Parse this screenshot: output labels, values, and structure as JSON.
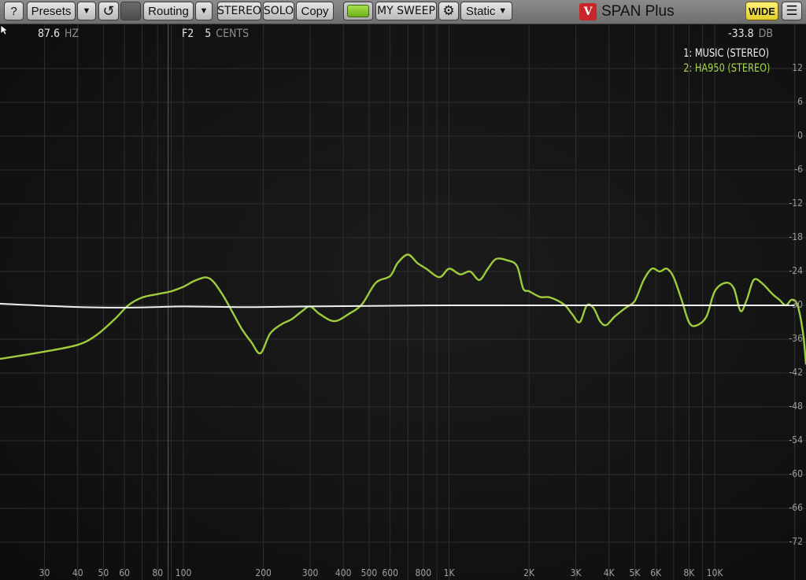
{
  "toolbar": {
    "help": "?",
    "presets": "Presets",
    "dropdown_arrow": "▼",
    "undo_icon": "↺",
    "routing": "Routing",
    "stereo": "STEREO",
    "solo": "SOLO",
    "copy": "Copy",
    "sweep": "MY SWEEP",
    "gear_icon": "⚙",
    "mode": "Static",
    "product": "SPAN Plus",
    "wide": "WIDE",
    "menu_icon": "☰"
  },
  "readout": {
    "freq": "87.6",
    "freq_unit": "HZ",
    "note": "F2",
    "cents": "5",
    "cents_unit": "CENTS",
    "level": "-33.8",
    "level_unit": "DB"
  },
  "legend": {
    "item1": "1: MUSIC (STEREO)",
    "item2": "2: HA950 (STEREO)"
  },
  "colors": {
    "series1": "#f0f0f0",
    "series2": "#9dcc3c",
    "grid": "#2e2e2e"
  },
  "y_axis": [
    "12",
    "6",
    "0",
    "-6",
    "-12",
    "-18",
    "-24",
    "-30",
    "-36",
    "-42",
    "-48",
    "-54",
    "-60",
    "-66",
    "-72"
  ],
  "x_axis": [
    {
      "f": 30,
      "label": "30"
    },
    {
      "f": 40,
      "label": "40"
    },
    {
      "f": 50,
      "label": "50"
    },
    {
      "f": 60,
      "label": "60"
    },
    {
      "f": 80,
      "label": "80"
    },
    {
      "f": 100,
      "label": "100"
    },
    {
      "f": 200,
      "label": "200"
    },
    {
      "f": 300,
      "label": "300"
    },
    {
      "f": 400,
      "label": "400"
    },
    {
      "f": 500,
      "label": "500"
    },
    {
      "f": 600,
      "label": "600"
    },
    {
      "f": 800,
      "label": "800"
    },
    {
      "f": 1000,
      "label": "1K"
    },
    {
      "f": 2000,
      "label": "2K"
    },
    {
      "f": 3000,
      "label": "3K"
    },
    {
      "f": 4000,
      "label": "4K"
    },
    {
      "f": 5000,
      "label": "5K"
    },
    {
      "f": 6000,
      "label": "6K"
    },
    {
      "f": 8000,
      "label": "8K"
    },
    {
      "f": 10000,
      "label": "10K"
    }
  ],
  "chart_data": {
    "type": "line",
    "x_scale": "log",
    "xlim_hz": [
      20.4,
      22050
    ],
    "ylim_db": [
      -75,
      15
    ],
    "grid": true,
    "legend_position": "top-right",
    "series": [
      {
        "name": "1: MUSIC (STEREO)",
        "x": [
          20.4,
          40,
          60,
          80,
          100,
          150,
          200,
          300,
          500,
          1000,
          2000,
          5000,
          10000,
          15000,
          20000
        ],
        "y": [
          -29.7,
          -30.3,
          -30.4,
          -30.3,
          -30.2,
          -30.3,
          -30.3,
          -30.2,
          -30.1,
          -30.0,
          -30.0,
          -30.0,
          -30.0,
          -30.0,
          -30.0
        ]
      },
      {
        "name": "2: HA950 (STEREO)",
        "x": [
          20.4,
          30,
          40,
          47,
          55,
          62,
          70,
          80,
          90,
          100,
          112,
          125,
          140,
          165,
          180,
          195,
          212,
          235,
          255,
          280,
          300,
          325,
          370,
          420,
          470,
          530,
          600,
          640,
          700,
          760,
          820,
          920,
          1000,
          1100,
          1200,
          1300,
          1400,
          1500,
          1650,
          1800,
          1900,
          2000,
          2200,
          2400,
          2700,
          2900,
          3100,
          3300,
          3500,
          3700,
          3900,
          4200,
          4600,
          5000,
          5400,
          5800,
          6200,
          6600,
          7000,
          7500,
          8000,
          8500,
          9300,
          10000,
          11000,
          11800,
          12500,
          13200,
          14000,
          15000,
          16500,
          17500,
          18500,
          19500,
          20500,
          21500,
          22050
        ],
        "y": [
          -39.5,
          -38.2,
          -37.0,
          -35.3,
          -32.5,
          -30.0,
          -28.6,
          -28.0,
          -27.5,
          -26.7,
          -25.5,
          -25.2,
          -28.0,
          -34.0,
          -36.5,
          -38.5,
          -35.0,
          -33.3,
          -32.5,
          -31.0,
          -30.2,
          -31.5,
          -32.8,
          -31.5,
          -29.8,
          -26.0,
          -24.8,
          -22.5,
          -21.0,
          -22.5,
          -23.5,
          -25.0,
          -23.5,
          -24.5,
          -24.0,
          -25.5,
          -23.5,
          -21.8,
          -22.0,
          -23.0,
          -27.0,
          -27.5,
          -28.5,
          -28.6,
          -29.8,
          -31.5,
          -33.0,
          -30.0,
          -30.5,
          -32.8,
          -33.5,
          -32.0,
          -30.5,
          -29.2,
          -25.5,
          -23.5,
          -24.0,
          -23.5,
          -25.0,
          -29.0,
          -33.0,
          -33.6,
          -32.0,
          -27.5,
          -26.0,
          -27.0,
          -31.0,
          -29.0,
          -25.5,
          -26.0,
          -28.0,
          -29.0,
          -30.0,
          -29.0,
          -30.0,
          -35.0,
          -40.5
        ]
      }
    ]
  }
}
